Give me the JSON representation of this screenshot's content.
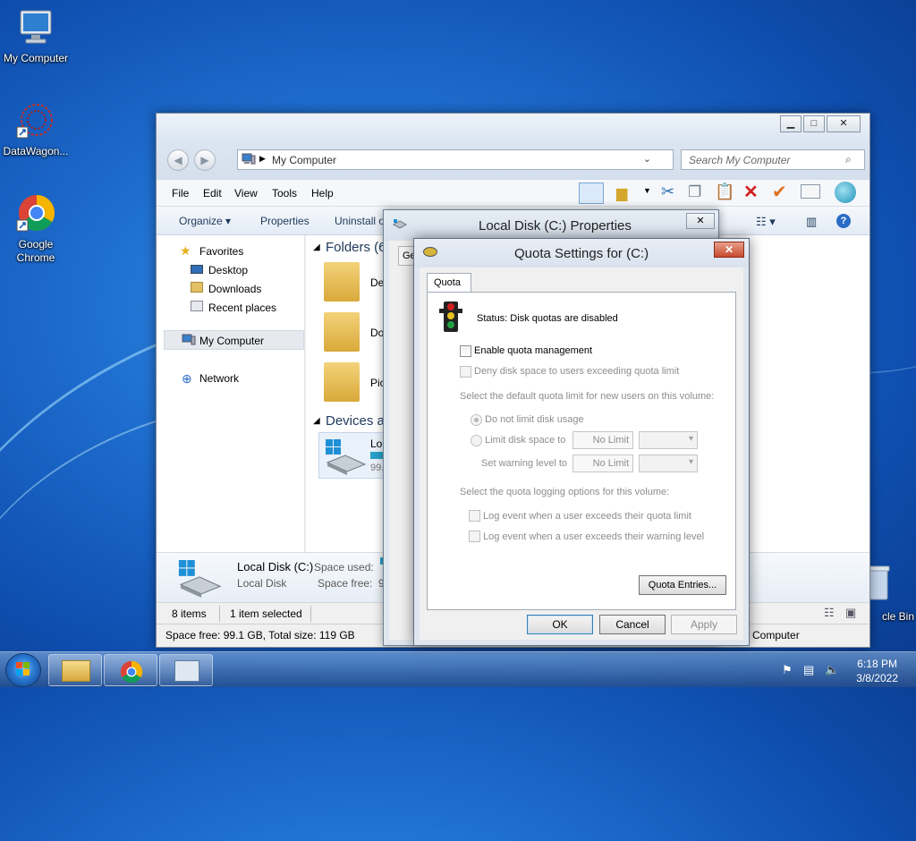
{
  "desktop": {
    "icons": [
      {
        "label": "My Computer"
      },
      {
        "label": "DataWagon..."
      },
      {
        "label": "Google Chrome"
      },
      {
        "label": "cle Bin"
      }
    ]
  },
  "explorer": {
    "address_path": "My Computer",
    "search_placeholder": "Search My Computer",
    "menu": [
      "File",
      "Edit",
      "View",
      "Tools",
      "Help"
    ],
    "commands": {
      "organize": "Organize",
      "properties": "Properties",
      "uninstall": "Uninstall o"
    },
    "nav": {
      "favorites": "Favorites",
      "desktop": "Desktop",
      "downloads": "Downloads",
      "recent": "Recent places",
      "my_computer": "My Computer",
      "network": "Network"
    },
    "content": {
      "folders_heading": "Folders (6",
      "folder_items": [
        "De",
        "Do",
        "Pic"
      ],
      "devices_heading": "Devices ar",
      "drive_label": "Lo",
      "drive_free": "99."
    },
    "details": {
      "name": "Local Disk (C:)",
      "type": "Local Disk",
      "space_used_label": "Space used:",
      "space_free_label": "Space free:",
      "space_free_partial": "9"
    },
    "status": {
      "items": "8 items",
      "selected": "1 item selected"
    },
    "status2": {
      "space": "Space free: 99.1 GB, Total size: 119 GB",
      "computer": "Computer"
    }
  },
  "properties_dialog": {
    "title": "Local Disk (C:) Properties",
    "tab_partial": "Ge"
  },
  "quota_dialog": {
    "title": "Quota Settings for  (C:)",
    "tab": "Quota",
    "status": "Status:  Disk quotas are disabled",
    "enable": "Enable quota management",
    "deny": "Deny disk space to users exceeding quota limit",
    "default_limit_heading": "Select the default quota limit for new users on this volume:",
    "no_limit_radio": "Do not limit disk usage",
    "limit_radio": "Limit disk space to",
    "limit_value": "No Limit",
    "warning_label": "Set warning level to",
    "warning_value": "No Limit",
    "logging_heading": "Select the quota logging options for this volume:",
    "log_quota": "Log event when a user exceeds their quota limit",
    "log_warning": "Log event when a user exceeds their warning level",
    "entries_button": "Quota Entries...",
    "ok": "OK",
    "cancel": "Cancel",
    "apply": "Apply"
  },
  "taskbar": {
    "time": "6:18 PM",
    "date": "3/8/2022"
  }
}
